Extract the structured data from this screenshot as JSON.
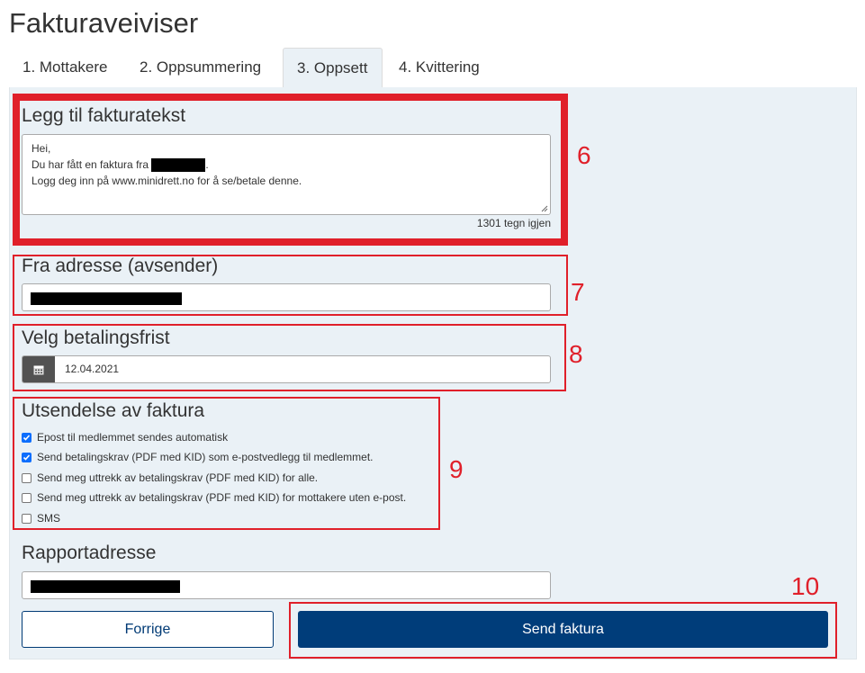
{
  "page": {
    "title": "Fakturaveiviser"
  },
  "tabs": [
    {
      "label": "1. Mottakere"
    },
    {
      "label": "2. Oppsummering"
    },
    {
      "label": "3. Oppsett"
    },
    {
      "label": "4. Kvittering"
    }
  ],
  "active_tab": "3. Oppsett",
  "invoice_text": {
    "label": "Legg til fakturatekst",
    "line1": "Hei,",
    "line2_prefix": "Du har fått en faktura fra",
    "line2_suffix": ".",
    "line3": "Logg deg inn på www.minidrett.no for å se/betale denne.",
    "counter": "1301 tegn igjen"
  },
  "from_address": {
    "label": "Fra adresse (avsender)"
  },
  "due_date": {
    "label": "Velg betalingsfrist",
    "value": "12.04.2021"
  },
  "sending": {
    "label": "Utsendelse av faktura",
    "options": [
      {
        "label": "Epost til medlemmet sendes automatisk",
        "checked": true
      },
      {
        "label": "Send betalingskrav (PDF med KID) som e-postvedlegg til medlemmet.",
        "checked": true
      },
      {
        "label": "Send meg uttrekk av betalingskrav (PDF med KID) for alle.",
        "checked": false
      },
      {
        "label": "Send meg uttrekk av betalingskrav (PDF med KID) for mottakere uten e-post.",
        "checked": false
      },
      {
        "label": "SMS",
        "checked": false
      }
    ]
  },
  "report_address": {
    "label": "Rapportadresse"
  },
  "buttons": {
    "previous": "Forrige",
    "send": "Send faktura"
  },
  "annotations": {
    "n6": "6",
    "n7": "7",
    "n8": "8",
    "n9": "9",
    "n10": "10"
  },
  "colors": {
    "annotation": "#e0202a",
    "primary": "#003d7a",
    "panel": "#eaf1f6",
    "checkbox": "#0d6efd"
  },
  "icons": {
    "calendar": "calendar-icon",
    "check": "checkmark-icon"
  }
}
